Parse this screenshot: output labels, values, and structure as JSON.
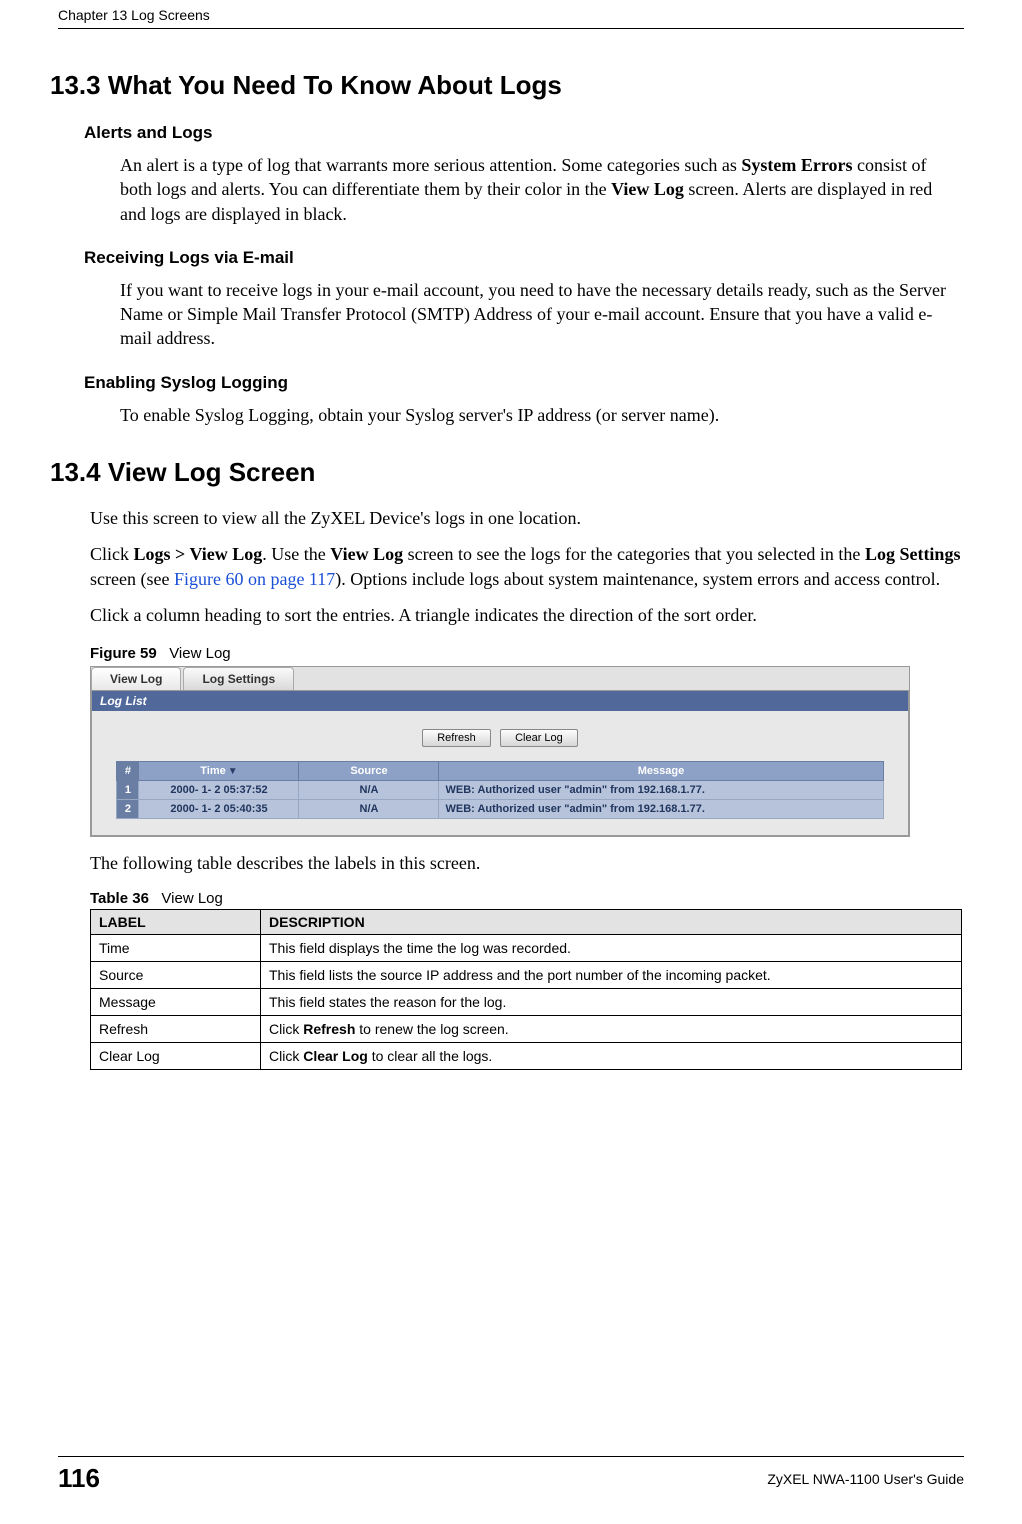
{
  "header": {
    "chapter": "Chapter 13 Log Screens"
  },
  "section133": {
    "title": "13.3  What You Need To Know About Logs",
    "alerts_head": "Alerts and Logs",
    "alerts_body": "An alert is a type of log that warrants more serious attention. Some categories such as System Errors consist of both logs and alerts. You can differentiate them by their color in the View Log screen. Alerts are displayed in red and logs are displayed in black.",
    "recv_head": "Receiving Logs via E-mail",
    "recv_body": "If you want to receive logs in your e-mail account, you need to have the necessary details ready, such as the Server Name or Simple Mail Transfer Protocol (SMTP) Address of your e-mail account. Ensure that you have a valid e-mail address.",
    "syslog_head": "Enabling Syslog Logging",
    "syslog_body": "To enable Syslog Logging, obtain your Syslog server's IP address (or server name)."
  },
  "section134": {
    "title": "13.4  View Log Screen",
    "p1": "Use this screen to view all the ZyXEL Device's logs in one location.",
    "p2a": "Click ",
    "p2b": "Logs > View Log",
    "p2c": ". Use the ",
    "p2d": "View Log",
    "p2e": " screen to see the logs for the categories that you selected in the ",
    "p2f": "Log Settings",
    "p2g": " screen (see ",
    "p2h": "Figure 60 on page 117",
    "p2i": "). Options include logs about system maintenance, system errors and access control.",
    "p3": "Click a column heading to sort the entries. A triangle indicates the direction of the sort order.",
    "figcap": "Figure 59   View Log",
    "tabs": {
      "viewlog": "View Log",
      "logsettings": "Log Settings"
    },
    "panel_head": "Log List",
    "btn_refresh": "Refresh",
    "btn_clear": "Clear Log",
    "cols": {
      "num": "#",
      "time": "Time",
      "source": "Source",
      "message": "Message"
    },
    "rows": [
      {
        "n": "1",
        "time": "2000- 1- 2 05:37:52",
        "src": "N/A",
        "msg": "WEB: Authorized user \"admin\" from 192.168.1.77."
      },
      {
        "n": "2",
        "time": "2000- 1- 2 05:40:35",
        "src": "N/A",
        "msg": "WEB: Authorized user \"admin\" from 192.168.1.77."
      }
    ],
    "below_fig": "The following table describes the labels in this screen.",
    "tblcap": "Table 36   View Log",
    "desc_head": {
      "label": "LABEL",
      "desc": "DESCRIPTION"
    },
    "desc_rows": [
      {
        "l": "Time",
        "d": "This field displays the time the log was recorded."
      },
      {
        "l": "Source",
        "d": "This field lists the source IP address and the port number of the incoming packet."
      },
      {
        "l": "Message",
        "d": "This field states the reason for the log."
      },
      {
        "l": "Refresh",
        "d_pre": "Click ",
        "d_bold": "Refresh",
        "d_post": " to renew the log screen."
      },
      {
        "l": "Clear Log",
        "d_pre": "Click ",
        "d_bold": "Clear Log",
        "d_post": " to clear all the logs."
      }
    ]
  },
  "footer": {
    "page": "116",
    "guide": "ZyXEL NWA-1100 User's Guide"
  }
}
